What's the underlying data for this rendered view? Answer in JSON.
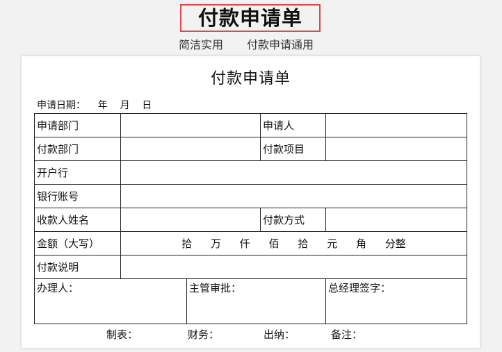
{
  "header": {
    "title": "付款申请单",
    "subtitle_left": "简洁实用",
    "subtitle_right": "付款申请通用"
  },
  "form": {
    "title": "付款申请单",
    "date_line": "申请日期：    年    月    日",
    "rows": {
      "dept_label": "申请部门",
      "applicant_label": "申请人",
      "pay_dept_label": "付款部门",
      "pay_item_label": "付款项目",
      "bank_label": "开户行",
      "account_label": "银行账号",
      "payee_label": "收款人姓名",
      "pay_method_label": "付款方式",
      "amount_label": "金额（大写）",
      "amount_units": [
        "拾",
        "万",
        "仟",
        "佰",
        "拾",
        "元",
        "角",
        "分整"
      ],
      "desc_label": "付款说明",
      "handler_label": "办理人：",
      "supervisor_label": "主管审批：",
      "gm_label": "总经理签字："
    },
    "footer": {
      "maker": "制表：",
      "finance": "财务：",
      "cashier": "出纳：",
      "note": "备注："
    }
  }
}
